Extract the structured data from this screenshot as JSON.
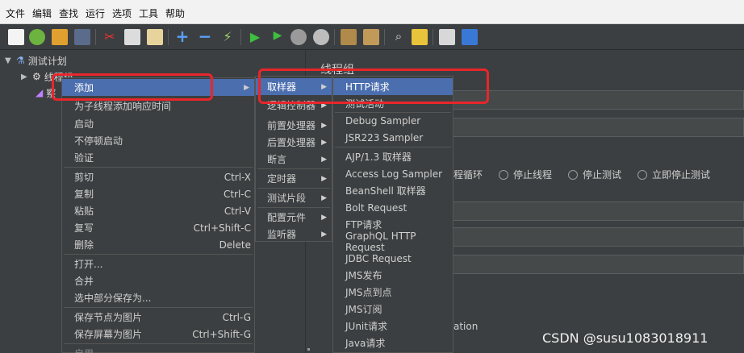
{
  "menubar": [
    "文件",
    "编辑",
    "查找",
    "运行",
    "选项",
    "工具",
    "帮助"
  ],
  "tree": {
    "root": "测试计划",
    "child1": "线程组",
    "child2": "察"
  },
  "panel": {
    "title": "线程组",
    "partial_text": "ation",
    "radios": [
      "程循环",
      "停止线程",
      "停止测试",
      "立即停止测试"
    ]
  },
  "context_menu": {
    "items": [
      {
        "label": "添加",
        "highlighted": true,
        "submenu": true
      },
      {
        "label": "为子线程添加响应时间"
      },
      {
        "label": "启动"
      },
      {
        "label": "不停顿启动"
      },
      {
        "label": "验证"
      },
      {
        "label": "剪切",
        "shortcut": "Ctrl-X"
      },
      {
        "label": "复制",
        "shortcut": "Ctrl-C"
      },
      {
        "label": "粘贴",
        "shortcut": "Ctrl-V"
      },
      {
        "label": "复写",
        "shortcut": "Ctrl+Shift-C"
      },
      {
        "label": "删除",
        "shortcut": "Delete"
      },
      {
        "label": "打开..."
      },
      {
        "label": "合并"
      },
      {
        "label": "选中部分保存为..."
      },
      {
        "label": "保存节点为图片",
        "shortcut": "Ctrl-G"
      },
      {
        "label": "保存屏幕为图片",
        "shortcut": "Ctrl+Shift-G"
      },
      {
        "label": "启用"
      }
    ]
  },
  "add_submenu": {
    "items": [
      {
        "label": "取样器",
        "highlighted": true
      },
      {
        "label": "逻辑控制器"
      },
      {
        "label": "前置处理器"
      },
      {
        "label": "后置处理器"
      },
      {
        "label": "断言"
      },
      {
        "label": "定时器"
      },
      {
        "label": "测试片段"
      },
      {
        "label": "配置元件"
      },
      {
        "label": "监听器"
      }
    ]
  },
  "sampler_submenu": {
    "items": [
      {
        "label": "HTTP请求",
        "highlighted": true
      },
      {
        "label": "测试活动"
      },
      {
        "label": "Debug Sampler"
      },
      {
        "label": "JSR223 Sampler"
      },
      {
        "label": "AJP/1.3 取样器"
      },
      {
        "label": "Access Log Sampler"
      },
      {
        "label": "BeanShell 取样器"
      },
      {
        "label": "Bolt Request"
      },
      {
        "label": "FTP请求"
      },
      {
        "label": "GraphQL HTTP Request"
      },
      {
        "label": "JDBC Request"
      },
      {
        "label": "JMS发布"
      },
      {
        "label": "JMS点到点"
      },
      {
        "label": "JMS订阅"
      },
      {
        "label": "JUnit请求"
      },
      {
        "label": "Java请求"
      }
    ]
  },
  "watermark": "CSDN @susu1083018911",
  "colors": {
    "highlight": "#4b6eaf",
    "annotation_red": "#e8262b",
    "bg": "#3c3f41"
  }
}
